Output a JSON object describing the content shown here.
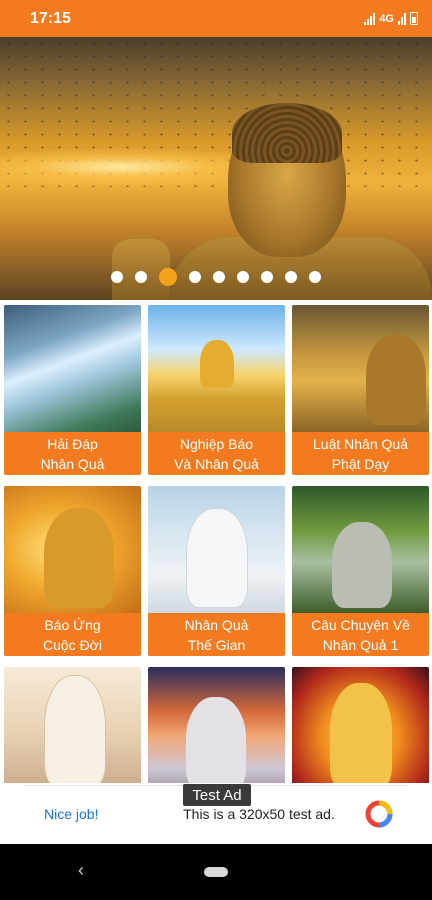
{
  "status_bar": {
    "time": "17:15",
    "network": "4G",
    "icons": [
      "signal-icon",
      "lte-icon",
      "signal-icon",
      "battery-icon"
    ]
  },
  "banner": {
    "slide_count": 9,
    "active_index": 2
  },
  "categories": [
    {
      "line1": "Hải Đáp",
      "line2": "Nhân Quả"
    },
    {
      "line1": "Nghiệp Báo",
      "line2": "Và Nhân Quả"
    },
    {
      "line1": "Luật Nhân Quả",
      "line2": "Phật Dạy"
    },
    {
      "line1": "Báo Ứng",
      "line2": "Cuộc Đời"
    },
    {
      "line1": "Nhân Quả",
      "line2": "Thế Gian"
    },
    {
      "line1": "Câu Chuyện Về",
      "line2": "Nhân Quả 1"
    },
    {
      "line1": "",
      "line2": ""
    },
    {
      "line1": "",
      "line2": ""
    },
    {
      "line1": "",
      "line2": ""
    }
  ],
  "ad": {
    "label": "Test Ad",
    "left_text": "Nice job!",
    "text": "This is a 320x50 test ad.",
    "icon": "ad-choices-icon"
  },
  "nav": {
    "back_icon": "back-icon",
    "home_icon": "home-pill-icon"
  },
  "colors": {
    "accent": "#f47a1f",
    "active_dot": "#f4a21c",
    "link_blue": "#1a73e8"
  }
}
